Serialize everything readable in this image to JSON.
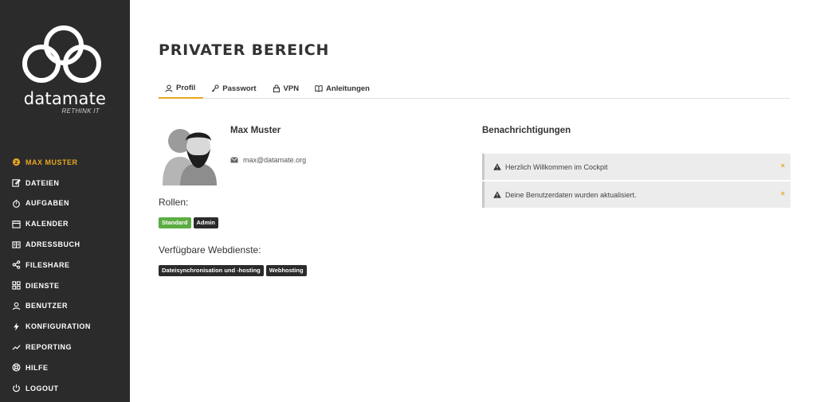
{
  "sidebar": {
    "brand": "datamate",
    "tagline": "RETHINK IT",
    "items": [
      {
        "label": "MAX MUSTER",
        "icon": "user-badge-icon"
      },
      {
        "label": "DATEIEN",
        "icon": "edit-file-icon"
      },
      {
        "label": "AUFGABEN",
        "icon": "stopwatch-icon"
      },
      {
        "label": "KALENDER",
        "icon": "calendar-icon"
      },
      {
        "label": "ADRESSBUCH",
        "icon": "address-book-icon"
      },
      {
        "label": "FILESHARE",
        "icon": "share-icon"
      },
      {
        "label": "DIENSTE",
        "icon": "grid-icon"
      },
      {
        "label": "BENUTZER",
        "icon": "users-icon"
      },
      {
        "label": "KONFIGURATION",
        "icon": "bolt-icon"
      },
      {
        "label": "REPORTING",
        "icon": "trend-icon"
      },
      {
        "label": "HILFE",
        "icon": "lifebuoy-icon"
      },
      {
        "label": "LOGOUT",
        "icon": "power-icon"
      }
    ]
  },
  "page": {
    "title": "PRIVATER BEREICH"
  },
  "tabs": [
    {
      "label": "Profil",
      "icon": "user-icon",
      "active": true
    },
    {
      "label": "Passwort",
      "icon": "key-icon"
    },
    {
      "label": "VPN",
      "icon": "lock-icon"
    },
    {
      "label": "Anleitungen",
      "icon": "book-icon"
    }
  ],
  "profile": {
    "name": "Max Muster",
    "email": "max@datamate.org",
    "roles_label": "Rollen:",
    "roles": [
      "Standard",
      "Admin"
    ],
    "services_label": "Verfügbare Webdienste:",
    "services": [
      "Dateisynchronisation und -hosting",
      "Webhosting"
    ]
  },
  "notifications": {
    "title": "Benachrichtigungen",
    "items": [
      {
        "text": "Herzlich Willkommen im Cockpit",
        "close": "×"
      },
      {
        "text": "Deine Benutzerdaten wurden aktualisiert.",
        "close": "×"
      }
    ]
  },
  "colors": {
    "sidebar_bg": "#2b2b2b",
    "accent": "#e8a722",
    "badge_green": "#5cac42",
    "badge_dark": "#2b2b2b",
    "notification_bg": "#ececec"
  }
}
